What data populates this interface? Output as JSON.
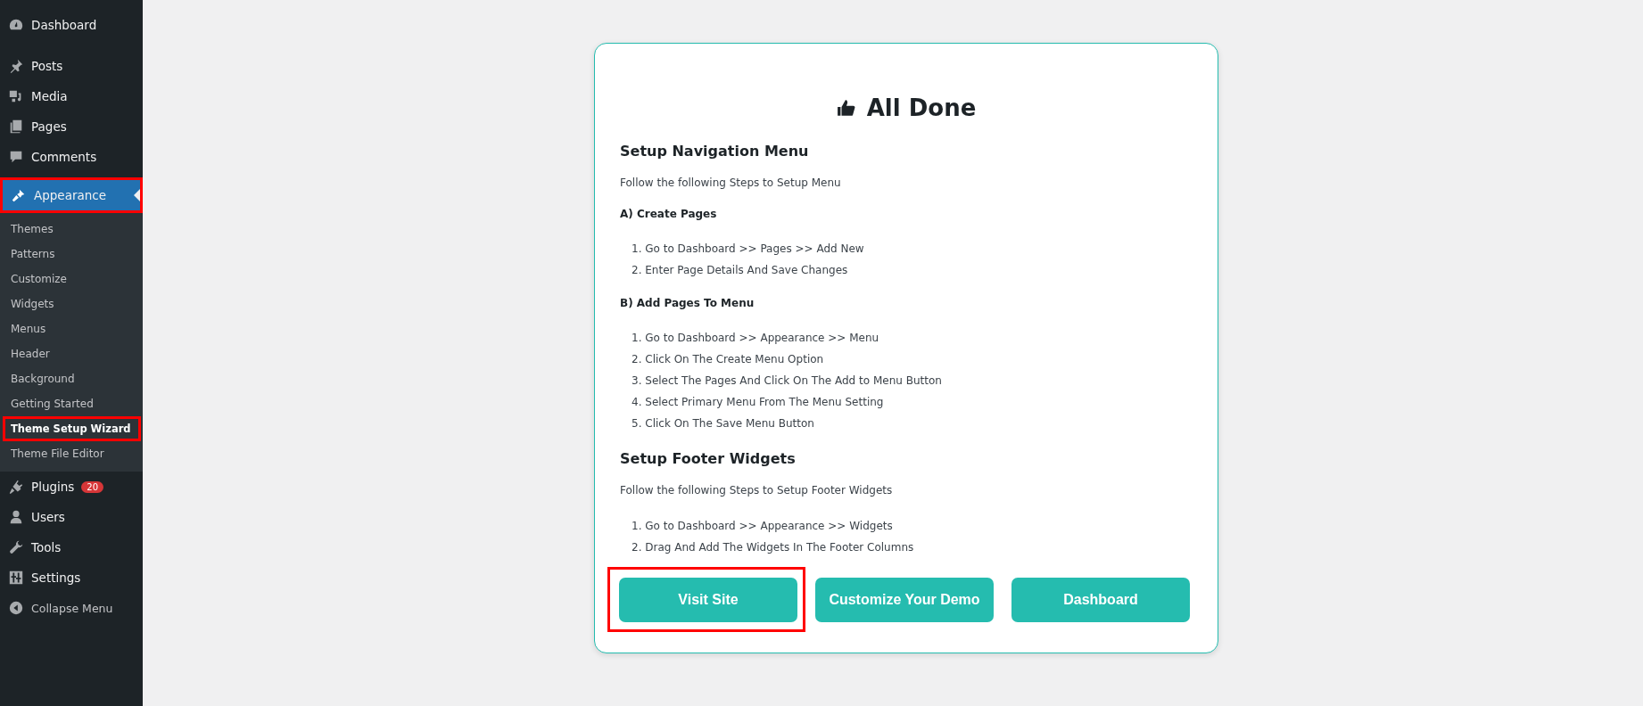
{
  "sidebar": {
    "items": [
      {
        "label": "Dashboard",
        "selected": false,
        "highlighted": false
      },
      {
        "label": "Posts",
        "selected": false,
        "highlighted": false
      },
      {
        "label": "Media",
        "selected": false,
        "highlighted": false
      },
      {
        "label": "Pages",
        "selected": false,
        "highlighted": false
      },
      {
        "label": "Comments",
        "selected": false,
        "highlighted": false
      },
      {
        "label": "Appearance",
        "selected": true,
        "highlighted": true,
        "children": [
          {
            "label": "Themes",
            "selected": false,
            "highlighted": false
          },
          {
            "label": "Patterns",
            "selected": false,
            "highlighted": false
          },
          {
            "label": "Customize",
            "selected": false,
            "highlighted": false
          },
          {
            "label": "Widgets",
            "selected": false,
            "highlighted": false
          },
          {
            "label": "Menus",
            "selected": false,
            "highlighted": false
          },
          {
            "label": "Header",
            "selected": false,
            "highlighted": false
          },
          {
            "label": "Background",
            "selected": false,
            "highlighted": false
          },
          {
            "label": "Getting Started",
            "selected": false,
            "highlighted": false
          },
          {
            "label": "Theme Setup Wizard",
            "selected": true,
            "highlighted": true
          },
          {
            "label": "Theme File Editor",
            "selected": false,
            "highlighted": false
          }
        ]
      },
      {
        "label": "Plugins",
        "selected": false,
        "highlighted": false,
        "badge": "20"
      },
      {
        "label": "Users",
        "selected": false,
        "highlighted": false
      },
      {
        "label": "Tools",
        "selected": false,
        "highlighted": false
      },
      {
        "label": "Settings",
        "selected": false,
        "highlighted": false
      }
    ],
    "collapse": {
      "label": "Collapse Menu"
    }
  },
  "card": {
    "title": "All Done",
    "sections": [
      {
        "heading": "Setup Navigation Menu",
        "intro": "Follow the following Steps to Setup Menu",
        "groups": [
          {
            "heading": "A) Create Pages",
            "steps": [
              "1. Go to Dashboard >> Pages >> Add New",
              "2. Enter Page Details And Save Changes"
            ]
          },
          {
            "heading": "B) Add Pages To Menu",
            "steps": [
              "1. Go to Dashboard >> Appearance >> Menu",
              "2. Click On The Create Menu Option",
              "3. Select The Pages And Click On The Add to Menu Button",
              "4. Select Primary Menu From The Menu Setting",
              "5. Click On The Save Menu Button"
            ]
          }
        ]
      },
      {
        "heading": "Setup Footer Widgets",
        "intro": "Follow the following Steps to Setup Footer Widgets",
        "groups": [
          {
            "steps": [
              "1. Go to Dashboard >> Appearance >> Widgets",
              "2. Drag And Add The Widgets In The Footer Columns"
            ]
          }
        ]
      }
    ],
    "buttons": [
      {
        "label": "Visit Site",
        "highlighted": true
      },
      {
        "label": "Customize Your Demo",
        "highlighted": false
      },
      {
        "label": "Dashboard",
        "highlighted": false
      }
    ]
  }
}
